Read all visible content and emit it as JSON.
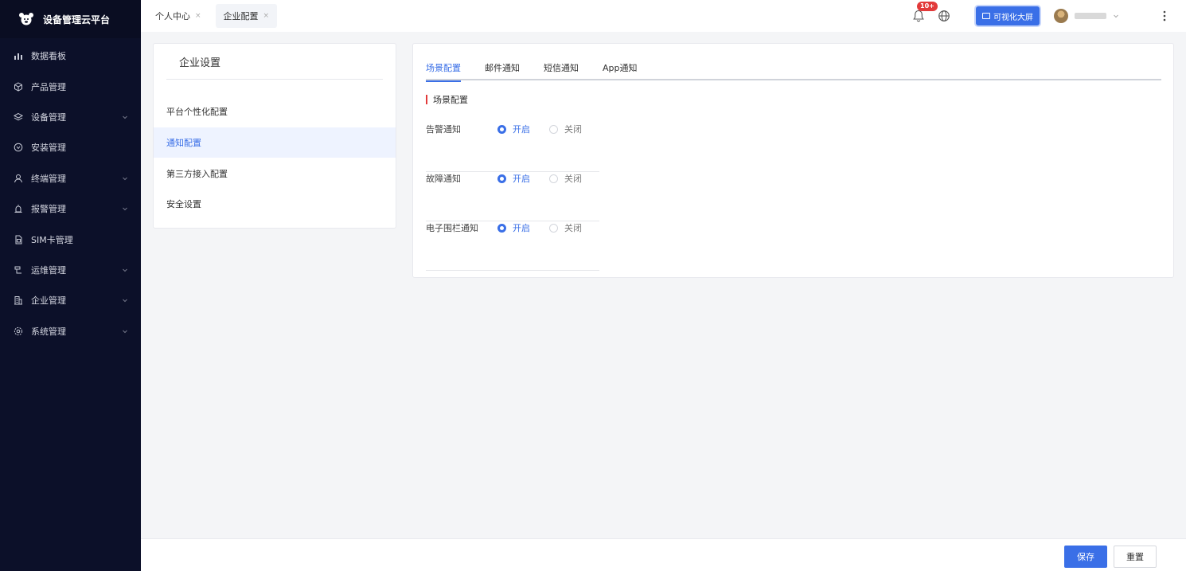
{
  "brand": {
    "title": "设备管理云平台"
  },
  "sidebar": {
    "items": [
      {
        "label": "数据看板",
        "icon": "bar-chart-icon",
        "expandable": false
      },
      {
        "label": "产品管理",
        "icon": "cube-icon",
        "expandable": false
      },
      {
        "label": "设备管理",
        "icon": "layers-icon",
        "expandable": true
      },
      {
        "label": "安装管理",
        "icon": "install-icon",
        "expandable": false
      },
      {
        "label": "终端管理",
        "icon": "user-icon",
        "expandable": true
      },
      {
        "label": "报警管理",
        "icon": "alarm-icon",
        "expandable": true
      },
      {
        "label": "SIM卡管理",
        "icon": "sim-card-icon",
        "expandable": false
      },
      {
        "label": "运维管理",
        "icon": "ops-icon",
        "expandable": true
      },
      {
        "label": "企业管理",
        "icon": "building-icon",
        "expandable": true
      },
      {
        "label": "系统管理",
        "icon": "gear-icon",
        "expandable": true
      }
    ]
  },
  "header": {
    "tabs": [
      {
        "label": "个人中心",
        "close": "×"
      },
      {
        "label": "企业配置",
        "close": "×"
      }
    ],
    "notification_badge": "10+",
    "bigscreen_label": "可视化大屏"
  },
  "settings": {
    "title": "企业设置",
    "items": [
      "平台个性化配置",
      "通知配置",
      "第三方接入配置",
      "安全设置"
    ],
    "active_index": 1
  },
  "content": {
    "tabs": [
      "场景配置",
      "邮件通知",
      "短信通知",
      "App通知"
    ],
    "active_tab": 0,
    "section_title": "场景配置",
    "rows": [
      {
        "label": "告警通知",
        "on_label": "开启",
        "off_label": "关闭",
        "value": "on"
      },
      {
        "label": "故障通知",
        "on_label": "开启",
        "off_label": "关闭",
        "value": "on"
      },
      {
        "label": "电子围栏通知",
        "on_label": "开启",
        "off_label": "关闭",
        "value": "on"
      }
    ]
  },
  "footer": {
    "save_label": "保存",
    "reset_label": "重置"
  },
  "colors": {
    "primary": "#3a6fe7",
    "sidebar_bg": "#0c1029",
    "accent_red": "#e23a3a"
  }
}
